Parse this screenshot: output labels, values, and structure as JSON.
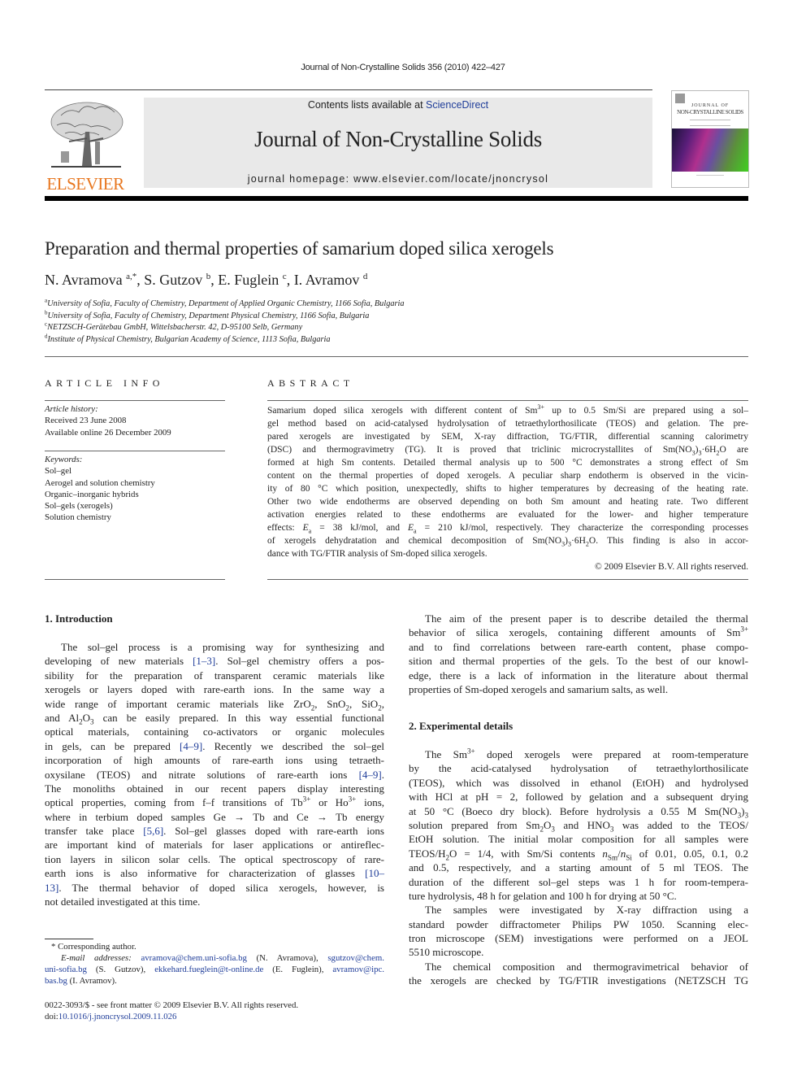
{
  "header": {
    "citation": "Journal of Non-Crystalline Solids 356 (2010) 422–427",
    "contents_prefix": "Contents lists available at ",
    "contents_link": "ScienceDirect",
    "journal_title": "Journal of Non-Crystalline Solids",
    "homepage": "journal homepage: www.elsevier.com/locate/jnoncrysol",
    "publisher_logo_text": "ELSEVIER",
    "cover": {
      "line1": "JOURNAL OF",
      "line2": "NON-CRYSTALLINE SOLIDS"
    },
    "colors": {
      "elsevier_orange": "#e8761e",
      "link_blue": "#1f3d99",
      "banner_gray": "#e9e9e9"
    }
  },
  "article": {
    "title": "Preparation and thermal properties of samarium doped silica xerogels",
    "authors": [
      {
        "name": "N. Avramova",
        "sup": "a,*"
      },
      {
        "name": "S. Gutzov",
        "sup": "b"
      },
      {
        "name": "E. Fuglein",
        "sup": "c"
      },
      {
        "name": "I. Avramov",
        "sup": "d"
      }
    ],
    "affiliations": [
      {
        "sup": "a",
        "text": "University of Sofia, Faculty of Chemistry, Department of Applied Organic Chemistry, 1166 Sofia, Bulgaria"
      },
      {
        "sup": "b",
        "text": "University of Sofia, Faculty of Chemistry, Department Physical Chemistry, 1166 Sofia, Bulgaria"
      },
      {
        "sup": "c",
        "text": "NETZSCH-Gerätebau GmbH, Wittelsbacherstr. 42, D-95100 Selb, Germany"
      },
      {
        "sup": "d",
        "text": "Institute of Physical Chemistry, Bulgarian Academy of Science, 1113 Sofia, Bulgaria"
      }
    ]
  },
  "article_info": {
    "heading": "ARTICLE INFO",
    "history_label": "Article history:",
    "received": "Received 23 June 2008",
    "available": "Available online 26 December 2009",
    "keywords_label": "Keywords:",
    "keywords": [
      "Sol–gel",
      "Aerogel and solution chemistry",
      "Organic–inorganic hybrids",
      "Sol–gels (xerogels)",
      "Solution chemistry"
    ]
  },
  "abstract": {
    "heading": "ABSTRACT",
    "lines": [
      [
        [
          "t",
          "Samarium doped silica xerogels with different content of Sm"
        ],
        [
          "sup",
          "3+"
        ],
        [
          "t",
          " up to 0.5 Sm/Si are prepared using a sol–"
        ]
      ],
      [
        [
          "t",
          "gel method based on acid-catalysed hydrolysation of tetraethylorthosilicate (TEOS) and gelation. The pre-"
        ]
      ],
      [
        [
          "t",
          "pared xerogels are investigated by SEM, X-ray diffraction, TG/FTIR, differential scanning calorimetry"
        ]
      ],
      [
        [
          "t",
          "(DSC) and thermogravimetry (TG). It is proved that triclinic microcrystallites of Sm(NO"
        ],
        [
          "sub",
          "3"
        ],
        [
          "t",
          ")"
        ],
        [
          "sub",
          "3"
        ],
        [
          "t",
          "·6H"
        ],
        [
          "sub",
          "2"
        ],
        [
          "t",
          "O are"
        ]
      ],
      [
        [
          "t",
          "formed at high Sm contents. Detailed thermal analysis up to 500 °C demonstrates a strong effect of Sm"
        ]
      ],
      [
        [
          "t",
          "content on the thermal properties of doped xerogels. A peculiar sharp endotherm is observed in the vicin-"
        ]
      ],
      [
        [
          "t",
          "ity of 80 °C which position, unexpectedly, shifts to higher temperatures by decreasing of the heating rate."
        ]
      ],
      [
        [
          "t",
          "Other two wide endotherms are observed depending on both Sm amount and heating rate. Two different"
        ]
      ],
      [
        [
          "t",
          "activation energies related to these endotherms are evaluated for the lower- and higher temperature"
        ]
      ],
      [
        [
          "t",
          "effects: "
        ],
        [
          "i",
          "E"
        ],
        [
          "sub",
          "a"
        ],
        [
          "t",
          " = 38 kJ/mol, and "
        ],
        [
          "i",
          "E"
        ],
        [
          "sub",
          "a"
        ],
        [
          "t",
          " = 210 kJ/mol, respectively. They characterize the corresponding processes"
        ]
      ],
      [
        [
          "t",
          "of xerogels dehydratation and chemical decomposition of Sm(NO"
        ],
        [
          "sub",
          "3"
        ],
        [
          "t",
          ")"
        ],
        [
          "sub",
          "3"
        ],
        [
          "t",
          "·6H"
        ],
        [
          "sub",
          "2"
        ],
        [
          "t",
          "O. This finding is also in accor-"
        ]
      ],
      [
        [
          "t",
          "dance with TG/FTIR analysis of Sm-doped silica xerogels."
        ]
      ]
    ],
    "copyright": "© 2009 Elsevier B.V. All rights reserved."
  },
  "intro": {
    "heading": "1. Introduction",
    "lines": [
      [
        [
          "t",
          "The sol–gel process is a promising way for synthesizing and"
        ]
      ],
      [
        [
          "t",
          "developing of new materials "
        ],
        [
          "a",
          "[1–3]"
        ],
        [
          "t",
          ". Sol–gel chemistry offers a pos-"
        ]
      ],
      [
        [
          "t",
          "sibility for the preparation of transparent ceramic materials like"
        ]
      ],
      [
        [
          "t",
          "xerogels or layers doped with rare-earth ions. In the same way a"
        ]
      ],
      [
        [
          "t",
          "wide range of important ceramic materials like ZrO"
        ],
        [
          "sub",
          "2"
        ],
        [
          "t",
          ", SnO"
        ],
        [
          "sub",
          "2"
        ],
        [
          "t",
          ", SiO"
        ],
        [
          "sub",
          "2"
        ],
        [
          "t",
          ","
        ]
      ],
      [
        [
          "t",
          "and Al"
        ],
        [
          "sub",
          "2"
        ],
        [
          "t",
          "O"
        ],
        [
          "sub",
          "3"
        ],
        [
          "t",
          " can be easily prepared. In this way essential functional"
        ]
      ],
      [
        [
          "t",
          "optical materials, containing co-activators or organic molecules"
        ]
      ],
      [
        [
          "t",
          "in gels, can be prepared "
        ],
        [
          "a",
          "[4–9]"
        ],
        [
          "t",
          ". Recently we described the sol–gel"
        ]
      ],
      [
        [
          "t",
          "incorporation of high amounts of rare-earth ions using tetraeth-"
        ]
      ],
      [
        [
          "t",
          "oxysilane (TEOS) and nitrate solutions of rare-earth ions "
        ],
        [
          "a",
          "[4–9]"
        ],
        [
          "t",
          "."
        ]
      ],
      [
        [
          "t",
          "The monoliths obtained in our recent papers display interesting"
        ]
      ],
      [
        [
          "t",
          "optical properties, coming from f–f transitions of Tb"
        ],
        [
          "sup",
          "3+"
        ],
        [
          "t",
          " or Ho"
        ],
        [
          "sup",
          "3+"
        ],
        [
          "t",
          " ions,"
        ]
      ],
      [
        [
          "t",
          "where in terbium doped samples Ge → Tb and Ce → Tb energy"
        ]
      ],
      [
        [
          "t",
          "transfer take place "
        ],
        [
          "a",
          "[5,6]"
        ],
        [
          "t",
          ". Sol–gel glasses doped with rare-earth ions"
        ]
      ],
      [
        [
          "t",
          "are important kind of materials for laser applications or antireflec-"
        ]
      ],
      [
        [
          "t",
          "tion layers in silicon solar cells. The optical spectroscopy of rare-"
        ]
      ],
      [
        [
          "t",
          "earth ions is also informative for characterization of glasses "
        ],
        [
          "a",
          "[10–"
        ]
      ],
      [
        [
          "a",
          "13]"
        ],
        [
          "t",
          ". The thermal behavior of doped silica xerogels, however, is"
        ]
      ],
      [
        [
          "t",
          "not detailed investigated at this time."
        ]
      ]
    ]
  },
  "footnotes": {
    "corresponding": "* Corresponding author.",
    "email_lines": [
      [
        [
          "i",
          "E-mail addresses: "
        ],
        [
          "a",
          "avramova@chem.uni-sofia.bg"
        ],
        [
          "t",
          " (N. Avramova), "
        ],
        [
          "a",
          "sgutzov@chem."
        ]
      ],
      [
        [
          "a",
          "uni-sofia.bg"
        ],
        [
          "t",
          " (S. Gutzov), "
        ],
        [
          "a",
          "ekkehard.fueglein@t-online.de"
        ],
        [
          "t",
          " (E. Fuglein), "
        ],
        [
          "a",
          "avramov@ipc."
        ]
      ],
      [
        [
          "a",
          "bas.bg"
        ],
        [
          "t",
          " (I. Avramov)."
        ]
      ]
    ],
    "front_matter": "0022-3093/$ - see front matter © 2009 Elsevier B.V. All rights reserved.",
    "doi_prefix": "doi:",
    "doi": "10.1016/j.jnoncrysol.2009.11.026"
  },
  "aim": {
    "lines": [
      [
        [
          "t",
          "The aim of the present paper is to describe detailed the thermal"
        ]
      ],
      [
        [
          "t",
          "behavior of silica xerogels, containing different amounts of Sm"
        ],
        [
          "sup",
          "3+"
        ]
      ],
      [
        [
          "t",
          "and to find correlations between rare-earth content, phase compo-"
        ]
      ],
      [
        [
          "t",
          "sition and thermal properties of the gels. To the best of our knowl-"
        ]
      ],
      [
        [
          "t",
          "edge, there is a lack of information in the literature about thermal"
        ]
      ],
      [
        [
          "t",
          "properties of Sm-doped xerogels and samarium salts, as well."
        ]
      ]
    ]
  },
  "experimental": {
    "heading": "2. Experimental details",
    "p1": [
      [
        [
          "t",
          "The Sm"
        ],
        [
          "sup",
          "3+"
        ],
        [
          "t",
          " doped xerogels were prepared at room-temperature"
        ]
      ],
      [
        [
          "t",
          "by the acid-catalysed hydrolysation of tetraethylorthosilicate"
        ]
      ],
      [
        [
          "t",
          "(TEOS), which was dissolved in ethanol (EtOH) and hydrolysed"
        ]
      ],
      [
        [
          "t",
          "with HCl at pH = 2, followed by gelation and a subsequent drying"
        ]
      ],
      [
        [
          "t",
          "at 50 °C (Boeco dry block). Before hydrolysis a 0.55 M Sm(NO"
        ],
        [
          "sub",
          "3"
        ],
        [
          "t",
          ")"
        ],
        [
          "sub",
          "3"
        ]
      ],
      [
        [
          "t",
          "solution prepared from Sm"
        ],
        [
          "sub",
          "2"
        ],
        [
          "t",
          "O"
        ],
        [
          "sub",
          "3"
        ],
        [
          "t",
          " and HNO"
        ],
        [
          "sub",
          "3"
        ],
        [
          "t",
          " was added to the TEOS/"
        ]
      ],
      [
        [
          "t",
          "EtOH solution. The initial molar composition for all samples were"
        ]
      ],
      [
        [
          "t",
          "TEOS/H"
        ],
        [
          "sub",
          "2"
        ],
        [
          "t",
          "O = 1/4, with Sm/Si contents "
        ],
        [
          "i",
          "n"
        ],
        [
          "sub",
          "Sm"
        ],
        [
          "t",
          "/"
        ],
        [
          "i",
          "n"
        ],
        [
          "sub",
          "Si"
        ],
        [
          "t",
          " of 0.01, 0.05, 0.1, 0.2"
        ]
      ],
      [
        [
          "t",
          "and 0.5, respectively, and a starting amount of 5 ml TEOS. The"
        ]
      ],
      [
        [
          "t",
          "duration of the different sol–gel steps was 1 h for room-tempera-"
        ]
      ],
      [
        [
          "t",
          "ture hydrolysis, 48 h for gelation and 100 h for drying at 50 °C."
        ]
      ]
    ],
    "p2": [
      [
        [
          "t",
          "The samples were investigated by X-ray diffraction using a"
        ]
      ],
      [
        [
          "t",
          "standard powder diffractometer Philips PW 1050. Scanning elec-"
        ]
      ],
      [
        [
          "t",
          "tron microscope (SEM) investigations were performed on a JEOL"
        ]
      ],
      [
        [
          "t",
          "5510 microscope."
        ]
      ]
    ],
    "p3": [
      [
        [
          "t",
          "The chemical composition and thermogravimetrical behavior of"
        ]
      ],
      [
        [
          "t",
          "the xerogels are checked by TG/FTIR investigations (NETZSCH TG"
        ]
      ]
    ]
  }
}
